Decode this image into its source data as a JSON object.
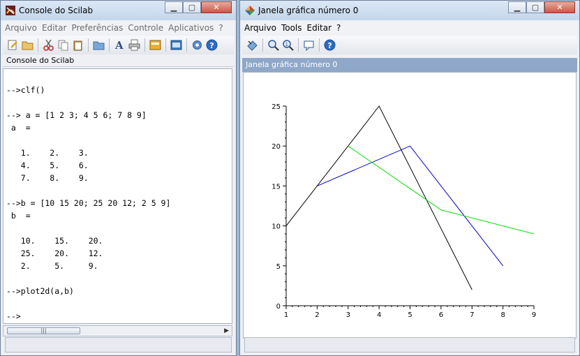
{
  "console_window": {
    "title": "Console do Scilab",
    "menu": [
      "Arquivo",
      "Editar",
      "Preferências",
      "Controle",
      "Aplicativos",
      "?"
    ],
    "toolbar_icons": [
      "new-script-icon",
      "open-file-icon",
      "cut-icon",
      "copy-icon",
      "paste-icon",
      "change-directory-icon",
      "font-icon",
      "print-icon",
      "clear-console-icon",
      "clear-history-icon",
      "modules-icon",
      "help-icon"
    ],
    "tab_label": "Console do Scilab",
    "console_text": "\n-->clf()\n\n--> a = [1 2 3; 4 5 6; 7 8 9]\n a  =\n\n   1.    2.    3.\n   4.    5.    6.\n   7.    8.    9.\n\n-->b = [10 15 20; 25 20 12; 2 5 9]\n b  =\n\n   10.    15.    20.\n   25.    20.    12.\n   2.     5.     9.\n\n-->plot2d(a,b)\n\n-->",
    "scroll_thumb": "|||"
  },
  "graphic_window": {
    "title": "Janela gráfica número 0",
    "menu": [
      "Arquivo",
      "Tools",
      "Editar",
      "?"
    ],
    "toolbar_icons": [
      "rotate-icon",
      "zoom-icon",
      "unzoom-icon",
      "datatip-icon",
      "help-icon"
    ],
    "tab_label": "Janela gráfica número 0"
  },
  "chart_data": {
    "type": "line",
    "title": "",
    "xlabel": "",
    "ylabel": "",
    "xlim": [
      1,
      9
    ],
    "ylim": [
      0,
      25
    ],
    "xticks": [
      1,
      2,
      3,
      4,
      5,
      6,
      7,
      8,
      9
    ],
    "yticks": [
      0,
      5,
      10,
      15,
      20,
      25
    ],
    "grid": false,
    "series": [
      {
        "x": [
          1,
          4,
          7
        ],
        "y": [
          10,
          25,
          2
        ],
        "color": "#000000"
      },
      {
        "x": [
          2,
          5,
          8
        ],
        "y": [
          15,
          20,
          5
        ],
        "color": "#0000cc"
      },
      {
        "x": [
          3,
          6,
          9
        ],
        "y": [
          20,
          12,
          9
        ],
        "color": "#00dd00"
      }
    ]
  }
}
